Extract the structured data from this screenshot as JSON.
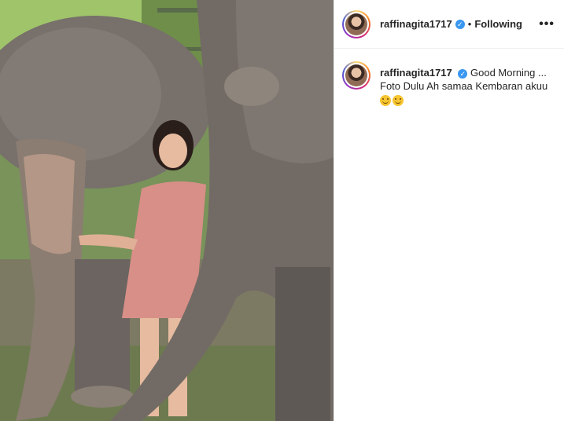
{
  "post": {
    "username": "raffinagita1717",
    "verified_symbol": "✓",
    "follow_status": "Following",
    "separator": "•",
    "more_label": "•••",
    "caption_line1": "Good Morning ...",
    "caption_line2": "Foto Dulu Ah samaa Kembaran akuu",
    "emojis": [
      "smiling-face-icon",
      "grinning-face-icon"
    ]
  },
  "colors": {
    "verified_badge": "#3897f0",
    "text": "#262626",
    "border": "#efefef"
  }
}
